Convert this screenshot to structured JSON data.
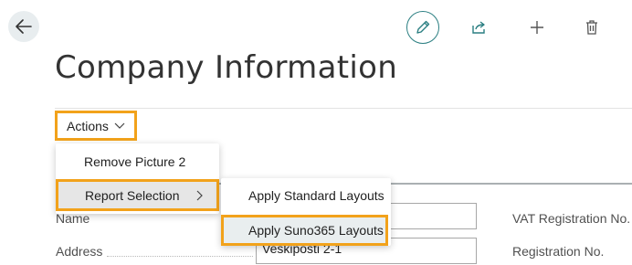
{
  "page": {
    "title": "Company Information"
  },
  "toolbar": {
    "back_icon": "arrow-left-icon",
    "edit_icon": "pencil-icon",
    "share_icon": "share-icon",
    "new_icon": "plus-icon",
    "delete_icon": "trash-icon",
    "accent_color": "#2b7f82"
  },
  "action_bar": {
    "actions_label": "Actions"
  },
  "actions_menu": {
    "items": [
      {
        "label": "Remove Picture 2"
      },
      {
        "label": "Report Selection"
      }
    ]
  },
  "report_selection_submenu": {
    "items": [
      {
        "label": "Apply Standard Layouts"
      },
      {
        "label": "Apply Suno365 Layouts"
      }
    ]
  },
  "fields": {
    "name_label": "Name",
    "address_label": "Address",
    "address_value": "Veskiposti 2-1",
    "vat_label": "VAT Registration No.",
    "registration_label": "Registration No."
  },
  "highlight_color": "#f2a21b"
}
